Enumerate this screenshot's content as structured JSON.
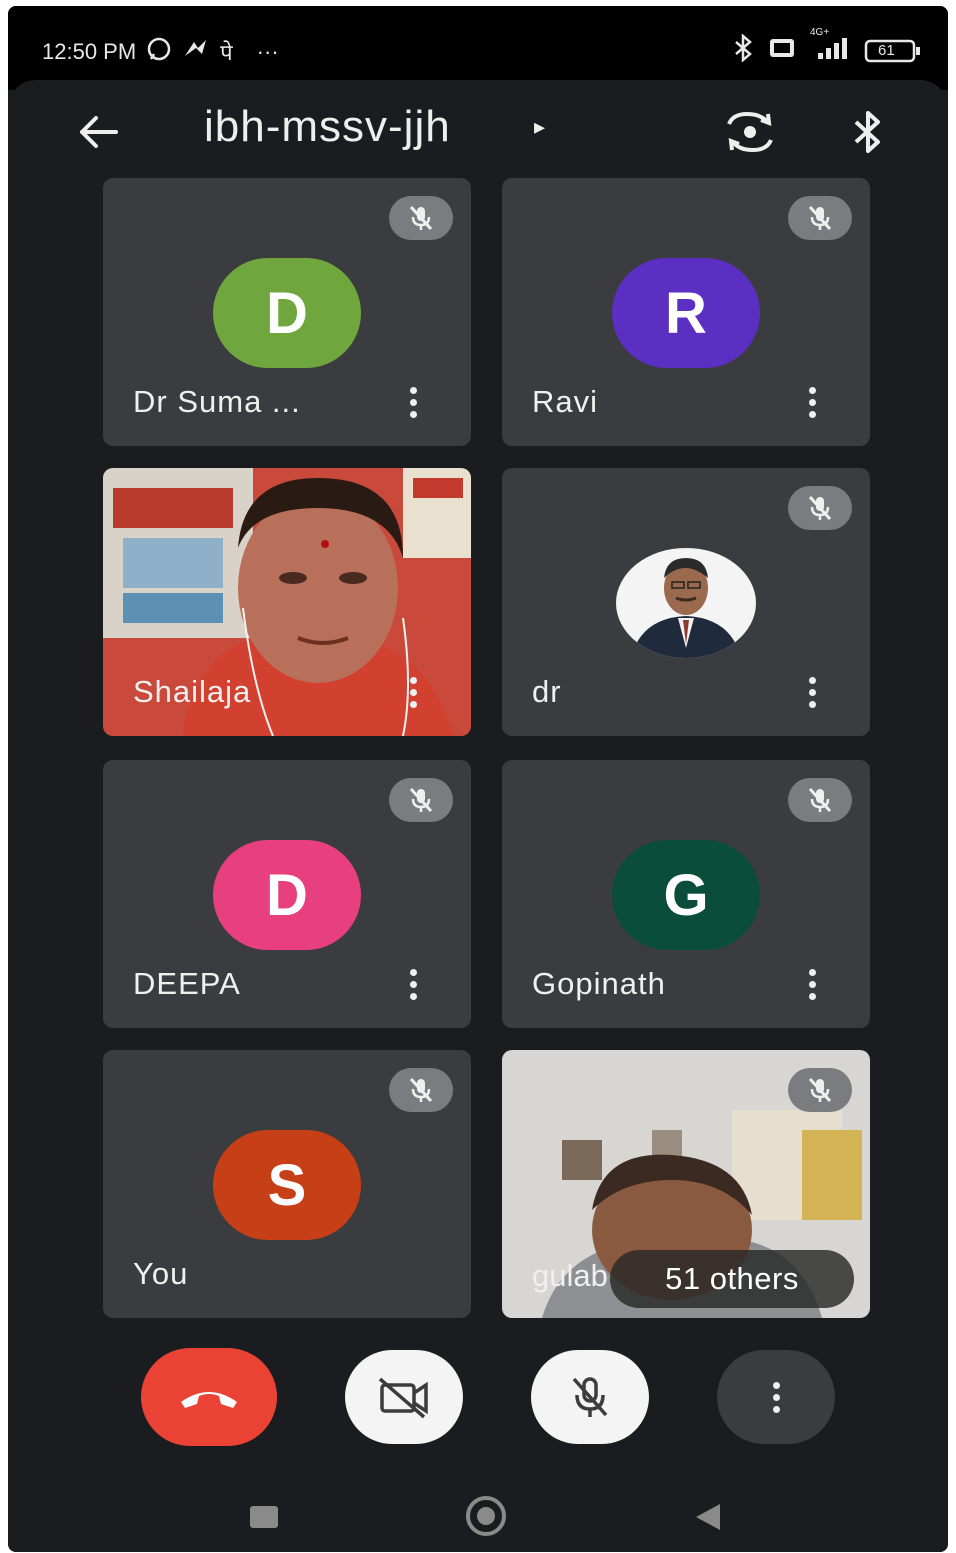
{
  "status_bar": {
    "time": "12:50 PM",
    "left_icons": [
      "whatsapp-icon",
      "app-icon",
      "notification-glyph",
      "more-notifications-icon"
    ],
    "notification_glyph": "पे",
    "overflow": "···",
    "right_icons": [
      "bluetooth-icon",
      "volte-icon",
      "signal-icon",
      "battery-icon"
    ],
    "network": "4G+",
    "battery": "61"
  },
  "header": {
    "meeting_code": "ibh-mssv-jjh",
    "title_arrow": "▸"
  },
  "participants": [
    {
      "name": "Dr Suma ...",
      "initial": "D",
      "avatar_color": "#6fa63d",
      "muted": true,
      "type": "avatar"
    },
    {
      "name": "Ravi",
      "initial": "R",
      "avatar_color": "#5b2fc2",
      "muted": true,
      "type": "avatar"
    },
    {
      "name": "Shailaja",
      "muted": false,
      "type": "video"
    },
    {
      "name": "dr",
      "muted": true,
      "type": "photo"
    },
    {
      "name": "DEEPA",
      "initial": "D",
      "avatar_color": "#e8407f",
      "muted": true,
      "type": "avatar"
    },
    {
      "name": "Gopinath",
      "initial": "G",
      "avatar_color": "#0b4d3b",
      "muted": true,
      "type": "avatar"
    },
    {
      "name": "You",
      "initial": "S",
      "avatar_color": "#c63f17",
      "muted": true,
      "type": "avatar"
    },
    {
      "name": "gulab",
      "muted": true,
      "type": "video",
      "others_label": "51 others"
    }
  ],
  "colors": {
    "background": "#1b1c1f",
    "tile": "#3b3c3f",
    "end_call": "#ea4335",
    "control_light": "#f4f4f4"
  },
  "controls": [
    "end-call-button",
    "camera-off-button",
    "microphone-off-button",
    "more-options-button"
  ]
}
